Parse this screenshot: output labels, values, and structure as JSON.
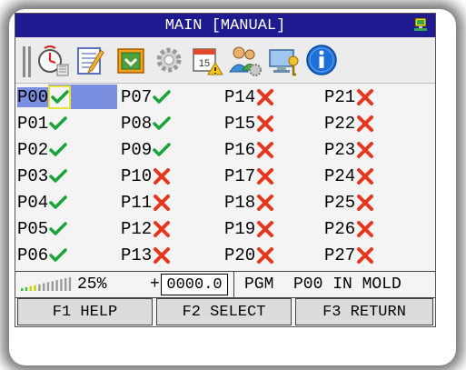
{
  "window": {
    "title": "MAIN [MANUAL]"
  },
  "toolbar": {
    "icons": [
      "clock-icon",
      "notepad-edit-icon",
      "mold-box-icon",
      "gear-icon",
      "calendar-warning-icon",
      "users-settings-icon",
      "computer-key-icon",
      "info-icon"
    ]
  },
  "programs": {
    "col1": [
      {
        "label": "P00",
        "status": "ok"
      },
      {
        "label": "P01",
        "status": "ok"
      },
      {
        "label": "P02",
        "status": "ok"
      },
      {
        "label": "P03",
        "status": "ok"
      },
      {
        "label": "P04",
        "status": "ok"
      },
      {
        "label": "P05",
        "status": "ok"
      },
      {
        "label": "P06",
        "status": "ok"
      }
    ],
    "col2": [
      {
        "label": "P07",
        "status": "ok"
      },
      {
        "label": "P08",
        "status": "ok"
      },
      {
        "label": "P09",
        "status": "ok"
      },
      {
        "label": "P10",
        "status": "error"
      },
      {
        "label": "P11",
        "status": "error"
      },
      {
        "label": "P12",
        "status": "error"
      },
      {
        "label": "P13",
        "status": "error"
      }
    ],
    "col3": [
      {
        "label": "P14",
        "status": "error"
      },
      {
        "label": "P15",
        "status": "error"
      },
      {
        "label": "P16",
        "status": "error"
      },
      {
        "label": "P17",
        "status": "error"
      },
      {
        "label": "P18",
        "status": "error"
      },
      {
        "label": "P19",
        "status": "error"
      },
      {
        "label": "P20",
        "status": "error"
      }
    ],
    "col4": [
      {
        "label": "P21",
        "status": "error"
      },
      {
        "label": "P22",
        "status": "error"
      },
      {
        "label": "P23",
        "status": "error"
      },
      {
        "label": "P24",
        "status": "error"
      },
      {
        "label": "P25",
        "status": "error"
      },
      {
        "label": "P26",
        "status": "error"
      },
      {
        "label": "P27",
        "status": "error"
      }
    ],
    "selected": "P00"
  },
  "status": {
    "level_percent": "25%",
    "level_fraction": 0.25,
    "sign": "+",
    "value": "0000.0",
    "message": "PGM  P00 IN MOLD"
  },
  "fkeys": {
    "f1": "F1 HELP",
    "f2": "F2 SELECT",
    "f3": "F3 RETURN"
  },
  "colors": {
    "title_bar": "#1f1a90",
    "selection": "#7b8fe0",
    "ok": "#1aa336",
    "error": "#e8361c"
  }
}
